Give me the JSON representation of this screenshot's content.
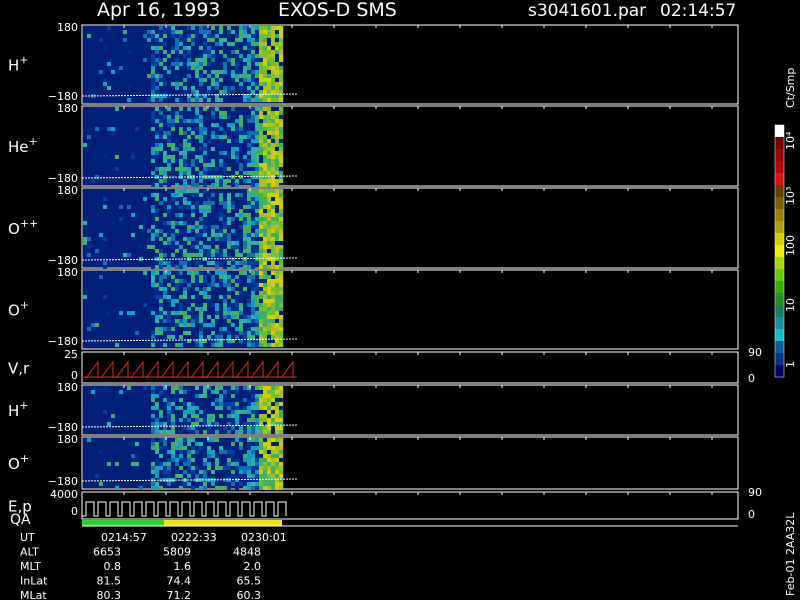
{
  "header": {
    "date": "Apr 16, 1993",
    "instrument": "EXOS-D SMS",
    "file": "s3041601.par",
    "time": "02:14:57"
  },
  "colors": {
    "spectrogram_low": "#00207a",
    "trace": "#ffffff",
    "velocity_trace": "#e03020",
    "qa_green": "#30d030",
    "qa_yellow": "#f0e020"
  },
  "panels": [
    {
      "label": "H",
      "sup": "+",
      "ytop": "180",
      "ybot": "−180",
      "rtop": "",
      "rbot": ""
    },
    {
      "label": "He",
      "sup": "+",
      "ytop": "180",
      "ybot": "−180",
      "rtop": "",
      "rbot": ""
    },
    {
      "label": "O",
      "sup": "++",
      "ytop": "180",
      "ybot": "−180",
      "rtop": "",
      "rbot": ""
    },
    {
      "label": "O",
      "sup": "+",
      "ytop": "180",
      "ybot": "−180",
      "rtop": "",
      "rbot": ""
    },
    {
      "label": "V,r",
      "sup": "",
      "ytop": "25",
      "ybot": "0",
      "rtop": "90",
      "rbot": "0"
    },
    {
      "label": "H",
      "sup": "+",
      "ytop": "180",
      "ybot": "−180",
      "rtop": "",
      "rbot": ""
    },
    {
      "label": "O",
      "sup": "+",
      "ytop": "180",
      "ybot": "−180",
      "rtop": "",
      "rbot": ""
    },
    {
      "label": "E,p",
      "sup": "",
      "ytop": "4000",
      "ybot": "0",
      "rtop": "90",
      "rbot": "0"
    }
  ],
  "qa_label": "QA",
  "colorbar": {
    "title": "Ct/Smp",
    "ticks": [
      "10⁴",
      "10³",
      "100",
      "10",
      "1"
    ],
    "stops": [
      "#ffffff",
      "#7a0000",
      "#a00000",
      "#c00000",
      "#e01010",
      "#604000",
      "#806000",
      "#a08000",
      "#b0a000",
      "#d0d000",
      "#f0f000",
      "#a0e000",
      "#60d000",
      "#30b000",
      "#209020",
      "#108060",
      "#1090a0",
      "#10c0d0",
      "#0060a0",
      "#003090",
      "#000060"
    ]
  },
  "ephemeris": {
    "rows": [
      {
        "label": "UT",
        "values": [
          "0214:57",
          "0222:33",
          "0230:01"
        ]
      },
      {
        "label": "ALT",
        "values": [
          "6653",
          "5809",
          "4848"
        ]
      },
      {
        "label": "MLT",
        "values": [
          "0.8",
          "1.6",
          "2.0"
        ]
      },
      {
        "label": "InLat",
        "values": [
          "81.5",
          "74.4",
          "65.5"
        ]
      },
      {
        "label": "MLat",
        "values": [
          "80.3",
          "71.2",
          "60.3"
        ]
      }
    ]
  },
  "footer_id": "Feb-01 2AA32L",
  "chart_data": {
    "type": "heatmap",
    "title": "Apr 16, 1993   EXOS-D SMS",
    "xlabel": "UT",
    "x_ticks": [
      "0214:57",
      "0222:33",
      "0230:01"
    ],
    "panels": [
      "H+",
      "He+",
      "O++",
      "O+",
      "V,r",
      "H+",
      "O+",
      "E,p"
    ],
    "ylim_pitch": [
      -180,
      180
    ],
    "ylim_vr": [
      0,
      25
    ],
    "ylim_ep": [
      0,
      4000
    ],
    "right_axis": [
      0,
      90
    ],
    "colorbar_range": [
      1,
      10000
    ],
    "colorbar_unit": "Ct/Smp",
    "log_scale": true
  }
}
